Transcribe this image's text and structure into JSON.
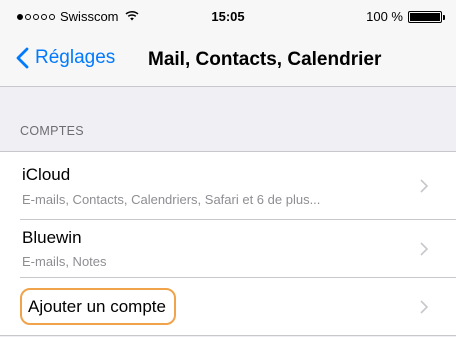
{
  "status_bar": {
    "carrier": "Swisscom",
    "time": "15:05",
    "battery": "100 %",
    "battery_level": 1.0,
    "signal_bars_filled": 1,
    "signal_bars_total": 5
  },
  "nav": {
    "back_label": "Réglages",
    "title": "Mail, Contacts, Calendrier"
  },
  "section": {
    "header": "COMPTES"
  },
  "accounts": [
    {
      "title": "iCloud",
      "subtitle": "E-mails, Contacts, Calendriers, Safari et 6 de plus..."
    },
    {
      "title": "Bluewin",
      "subtitle": "E-mails, Notes"
    }
  ],
  "add_account": {
    "label": "Ajouter un compte"
  },
  "colors": {
    "tint": "#007aff",
    "highlight": "#f0a34a",
    "background": "#efeff4",
    "separator": "#c8c7cc",
    "secondary_text": "#8e8e93"
  },
  "icons": {
    "back": "chevron-left-icon",
    "disclosure": "chevron-right-icon",
    "wifi": "wifi-icon",
    "battery": "battery-icon"
  }
}
